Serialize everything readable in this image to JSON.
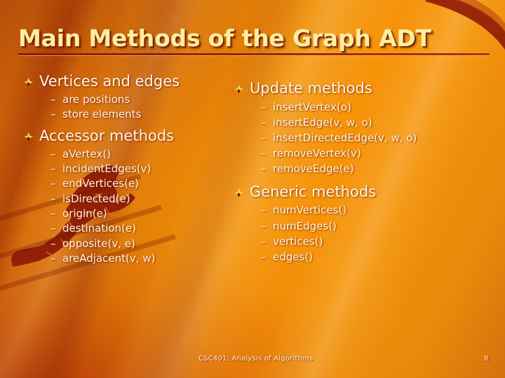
{
  "slide": {
    "title": "Main Methods of the Graph ADT",
    "accent_color": "#ffeea2",
    "background_color": "#ef8f08",
    "rule_color": "#9d2406",
    "text_color": "#fdf3df"
  },
  "bullet_icon": "gold-diamond-bullet",
  "dash": "–",
  "left_column": [
    {
      "heading": "Vertices and edges",
      "items": [
        "are positions",
        "store elements"
      ]
    },
    {
      "heading": "Accessor methods",
      "items": [
        "aVertex()",
        "incidentEdges(v)",
        "endVertices(e)",
        "isDirected(e)",
        "origin(e)",
        "destination(e)",
        "opposite(v, e)",
        "areAdjacent(v, w)"
      ]
    }
  ],
  "right_column": [
    {
      "heading": "Update methods",
      "items": [
        "insertVertex(o)",
        "insertEdge(v, w, o)",
        "insertDirectedEdge(v, w, o)",
        "removeVertex(v)",
        "removeEdge(e)"
      ]
    },
    {
      "heading": "Generic methods",
      "items": [
        "numVertices()",
        "numEdges()",
        "vertices()",
        "edges()"
      ]
    }
  ],
  "footer": {
    "course": "CSC401: Analysis of Algorithms",
    "page_number": "8"
  }
}
